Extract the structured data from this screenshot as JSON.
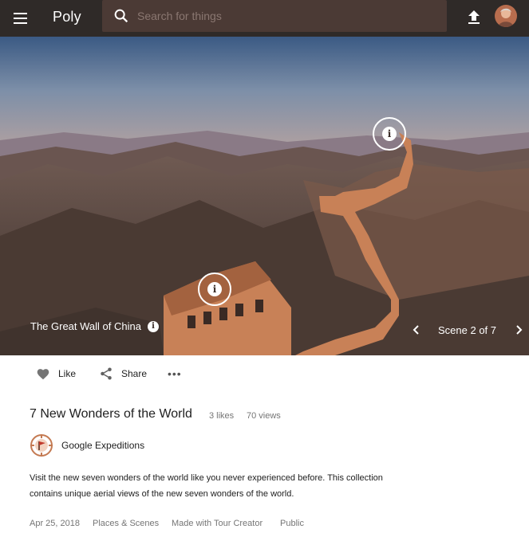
{
  "header": {
    "logo_text": "Poly",
    "search_placeholder": "Search for things",
    "menu_icon": "menu-icon",
    "upload_icon": "upload-icon"
  },
  "hero": {
    "scene_title": "The Great Wall of China",
    "scene_counter": "Scene 2 of 7",
    "info_glyph": "i"
  },
  "actions": {
    "like_label": "Like",
    "share_label": "Share",
    "more_label": "•••"
  },
  "collection": {
    "title": "7 New Wonders of the World",
    "likes": "3 likes",
    "views": "70 views",
    "author": "Google Expeditions",
    "description_line1": "Visit the new seven wonders of the world like you never experienced before. This collection",
    "description_line2": "contains unique aerial views of the new seven wonders of the world.",
    "date": "Apr 25, 2018",
    "category": "Places & Scenes",
    "made_with": "Made with Tour Creator",
    "visibility": "Public"
  },
  "colors": {
    "topbar": "#2f2a28",
    "search_bg": "#4b3a35",
    "wall": "#c88157",
    "text_secondary": "#757575"
  }
}
